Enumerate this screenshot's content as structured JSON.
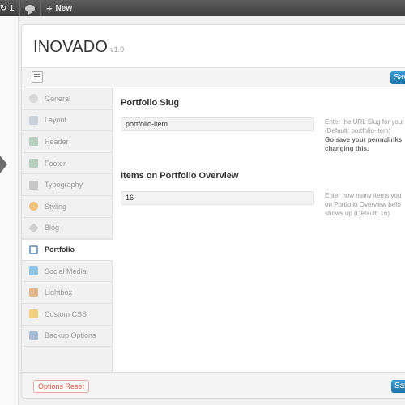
{
  "admin_bar": {
    "updates_count": "1",
    "new_label": "New"
  },
  "panel": {
    "logo": "INOVADO",
    "version": "v1.0",
    "save_label": "Save",
    "reset_label": "Options Reset"
  },
  "sidebar": {
    "items": [
      {
        "label": "General",
        "icon": "general-icon",
        "color": "#d8d8d8"
      },
      {
        "label": "Layout",
        "icon": "layout-icon",
        "color": "#c9d3dc"
      },
      {
        "label": "Header",
        "icon": "header-icon",
        "color": "#b9cfc0"
      },
      {
        "label": "Footer",
        "icon": "footer-icon",
        "color": "#b9cfc0"
      },
      {
        "label": "Typography",
        "icon": "typography-icon",
        "color": "#c8c8c8"
      },
      {
        "label": "Styling",
        "icon": "styling-icon",
        "color": "#f1c27a"
      },
      {
        "label": "Blog",
        "icon": "blog-icon",
        "color": "#cfcfcf"
      },
      {
        "label": "Portfolio",
        "icon": "portfolio-icon",
        "color": "#7fa3c9"
      },
      {
        "label": "Social Media",
        "icon": "social-media-icon",
        "color": "#8fc6e6"
      },
      {
        "label": "Lightbox",
        "icon": "lightbox-icon",
        "color": "#e0b88a"
      },
      {
        "label": "Custom CSS",
        "icon": "custom-css-icon",
        "color": "#f0cf7e"
      },
      {
        "label": "Backup Options",
        "icon": "backup-options-icon",
        "color": "#a7bdd6"
      }
    ],
    "active_index": 7
  },
  "content": {
    "sections": [
      {
        "title": "Portfolio Slug",
        "value": "portfolio-item",
        "desc_line1": "Enter the URL Slug for your",
        "desc_line2": "(Default: portfolio-item)",
        "desc_bold1": "Go save your permalinks",
        "desc_bold2": "changing this."
      },
      {
        "title": "Items on Portfolio Overview",
        "value": "16",
        "desc_line1": "Enter how many items you",
        "desc_line2": "on Portfolio Overview befo",
        "desc_line3": "shows up (Default: 16)"
      }
    ]
  },
  "colors": {
    "accent": "#2a8bc4",
    "reset": "#d2523c"
  }
}
